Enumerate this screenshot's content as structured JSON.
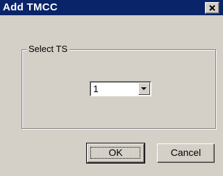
{
  "window": {
    "title": "Add TMCC",
    "close_glyph": "close-icon"
  },
  "group": {
    "legend": "Select TS"
  },
  "ts_select": {
    "value": "1",
    "button_icon": "chevron-down-icon"
  },
  "buttons": {
    "ok_label": "OK",
    "cancel_label": "Cancel"
  },
  "colors": {
    "titlebar": "#0a246a",
    "face": "#d4d0c8"
  }
}
